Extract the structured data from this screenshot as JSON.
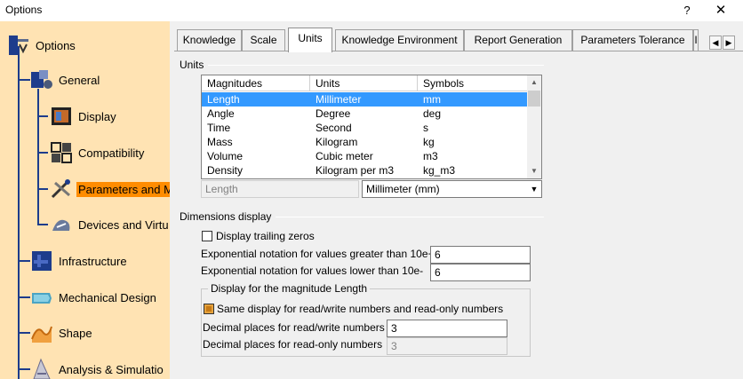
{
  "window": {
    "title": "Options",
    "help": "?",
    "close": "✕"
  },
  "tree": {
    "items": [
      {
        "label": "Options",
        "icon": "options-root-icon"
      },
      {
        "label": "General",
        "icon": "general-icon"
      },
      {
        "label": "Display",
        "icon": "display-icon"
      },
      {
        "label": "Compatibility",
        "icon": "compatibility-icon"
      },
      {
        "label": "Parameters and M",
        "icon": "parameters-icon",
        "selected": true
      },
      {
        "label": "Devices and Virtu",
        "icon": "devices-icon"
      },
      {
        "label": "Infrastructure",
        "icon": "infrastructure-icon"
      },
      {
        "label": "Mechanical Design",
        "icon": "mechanical-design-icon"
      },
      {
        "label": "Shape",
        "icon": "shape-icon"
      },
      {
        "label": "Analysis & Simulatio",
        "icon": "analysis-icon"
      }
    ]
  },
  "tabs": [
    {
      "label": "Knowledge"
    },
    {
      "label": "Scale"
    },
    {
      "label": "Units",
      "active": true
    },
    {
      "label": "Knowledge Environment"
    },
    {
      "label": "Report Generation"
    },
    {
      "label": "Parameters Tolerance"
    },
    {
      "label": "I"
    }
  ],
  "tab_scroll": {
    "left": "◀",
    "right": "▶"
  },
  "units": {
    "group_title": "Units",
    "columns": [
      "Magnitudes",
      "Units",
      "Symbols"
    ],
    "rows": [
      {
        "magnitude": "Length",
        "unit": "Millimeter",
        "symbol": "mm"
      },
      {
        "magnitude": "Angle",
        "unit": "Degree",
        "symbol": "deg"
      },
      {
        "magnitude": "Time",
        "unit": "Second",
        "symbol": "s"
      },
      {
        "magnitude": "Mass",
        "unit": "Kilogram",
        "symbol": "kg"
      },
      {
        "magnitude": "Volume",
        "unit": "Cubic meter",
        "symbol": "m3"
      },
      {
        "magnitude": "Density",
        "unit": "Kilogram per m3",
        "symbol": "kg_m3"
      }
    ],
    "scroll_up": "▲",
    "scroll_down": "▼",
    "selected_magnitude": "Length",
    "selected_unit": "Millimeter (mm)",
    "combo_arrow": "▼"
  },
  "dimensions": {
    "group_title": "Dimensions display",
    "trailing_zeros_label": "Display trailing zeros",
    "trailing_zeros_checked": false,
    "exp_greater_label": "Exponential notation for values greater than 10e+",
    "exp_greater_value": "6",
    "exp_lower_label": "Exponential notation for values lower than 10e-",
    "exp_lower_value": "6",
    "magnitude_group_title": "Display for the magnitude Length",
    "same_display_label": "Same display for read/write numbers and read-only numbers",
    "same_display_checked": true,
    "rw_label": "Decimal places for read/write numbers",
    "rw_value": "3",
    "ro_label": "Decimal places for read-only numbers",
    "ro_value": "3"
  }
}
